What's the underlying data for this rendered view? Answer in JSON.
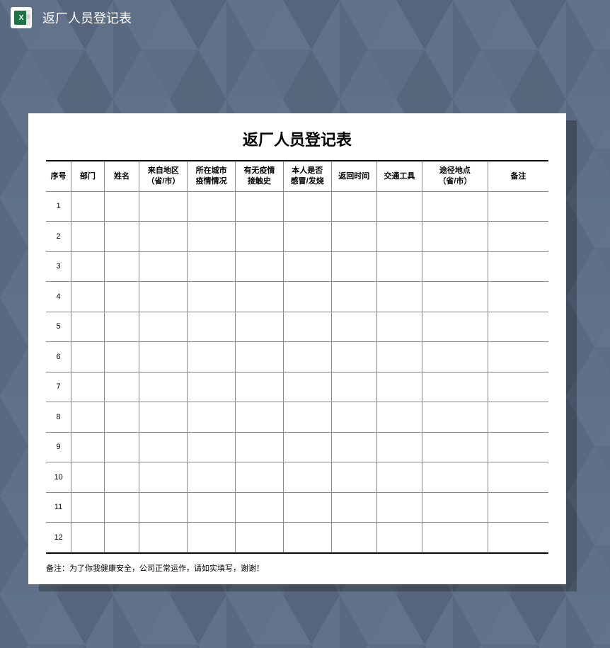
{
  "header": {
    "title": "返厂人员登记表"
  },
  "document": {
    "title": "返厂人员登记表",
    "columns": [
      "序号",
      "部门",
      "姓名",
      "来自地区\n（省/市）",
      "所在城市\n疫情情况",
      "有无疫情\n接触史",
      "本人是否\n感冒/发烧",
      "返回时间",
      "交通工具",
      "途径地点\n（省/市）",
      "备注"
    ],
    "rows": [
      {
        "seq": "1"
      },
      {
        "seq": "2"
      },
      {
        "seq": "3"
      },
      {
        "seq": "4"
      },
      {
        "seq": "5"
      },
      {
        "seq": "6"
      },
      {
        "seq": "7"
      },
      {
        "seq": "8"
      },
      {
        "seq": "9"
      },
      {
        "seq": "10"
      },
      {
        "seq": "11"
      },
      {
        "seq": "12"
      }
    ],
    "footer_note": "备注：为了你我健康安全，公司正常运作，请如实填写，谢谢！"
  }
}
